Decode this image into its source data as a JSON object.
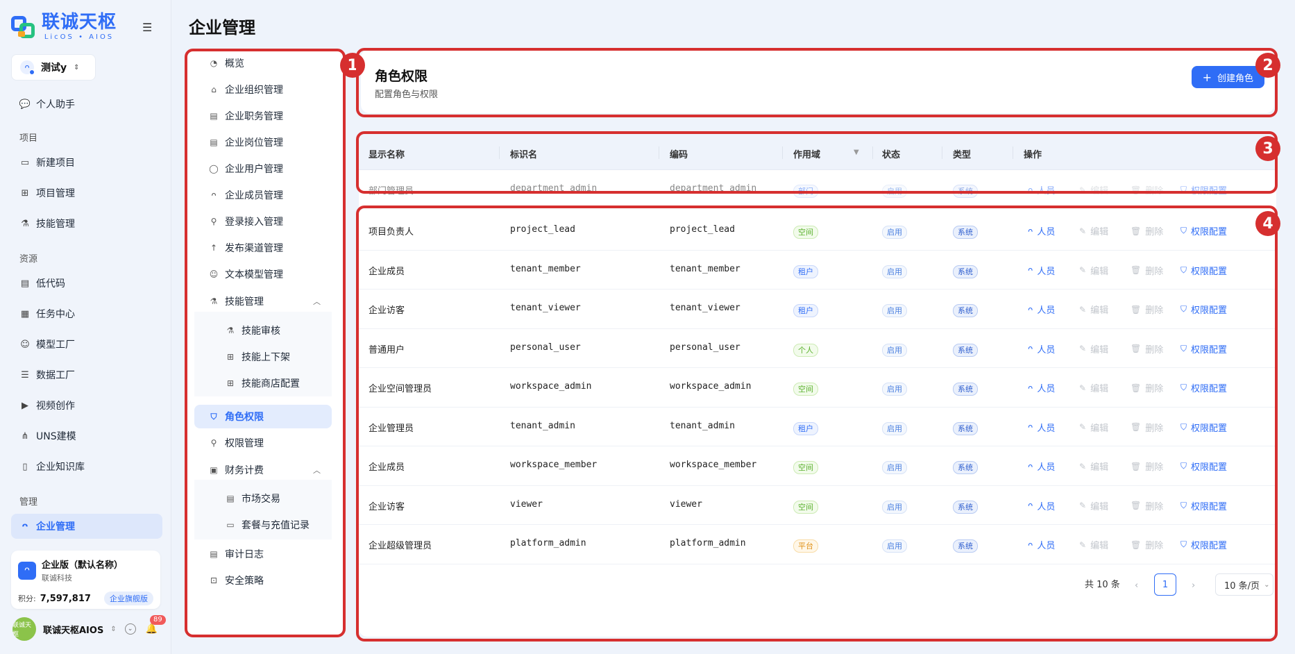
{
  "brand": {
    "title": "联诚天枢",
    "subtitle": "LicOS • AIOS"
  },
  "tenant_switch": {
    "label": "测试y"
  },
  "left_nav": {
    "top_items": [
      {
        "label": "个人助手",
        "icon": "chat-icon"
      }
    ],
    "groups": [
      {
        "label": "项目",
        "items": [
          {
            "label": "新建项目",
            "icon": "monitor-icon"
          },
          {
            "label": "项目管理",
            "icon": "grid-icon"
          },
          {
            "label": "技能管理",
            "icon": "flask-icon"
          }
        ]
      },
      {
        "label": "资源",
        "items": [
          {
            "label": "低代码",
            "icon": "doc-icon"
          },
          {
            "label": "任务中心",
            "icon": "calendar-icon"
          },
          {
            "label": "模型工厂",
            "icon": "robot-icon"
          },
          {
            "label": "数据工厂",
            "icon": "database-icon"
          },
          {
            "label": "视频创作",
            "icon": "video-icon"
          },
          {
            "label": "UNS建模",
            "icon": "nodes-icon"
          },
          {
            "label": "企业知识库",
            "icon": "book-icon"
          }
        ]
      },
      {
        "label": "管理",
        "items": [
          {
            "label": "企业管理",
            "icon": "users-icon",
            "active": true
          }
        ]
      }
    ]
  },
  "enterprise_card": {
    "name": "企业版（默认名称）",
    "org": "联诚科技",
    "points_label": "积分:",
    "points_value": "7,597,817",
    "plan": "企业旗舰版"
  },
  "bottom_user": {
    "avatar_text": "联诚天枢",
    "name": "联诚天枢AIOS",
    "notifications": "89"
  },
  "page": {
    "title": "企业管理"
  },
  "sub_nav": [
    {
      "label": "概览",
      "icon": "dashboard-icon"
    },
    {
      "label": "企业组织管理",
      "icon": "building-icon"
    },
    {
      "label": "企业职务管理",
      "icon": "doc-icon"
    },
    {
      "label": "企业岗位管理",
      "icon": "doc-icon"
    },
    {
      "label": "企业用户管理",
      "icon": "user-icon"
    },
    {
      "label": "企业成员管理",
      "icon": "users-icon"
    },
    {
      "label": "登录接入管理",
      "icon": "key-icon"
    },
    {
      "label": "发布渠道管理",
      "icon": "rocket-icon"
    },
    {
      "label": "文本模型管理",
      "icon": "robot-icon"
    },
    {
      "label": "技能管理",
      "icon": "flask-icon",
      "expanded": true
    },
    {
      "label": "技能审核",
      "icon": "flask-icon",
      "child": true
    },
    {
      "label": "技能上下架",
      "icon": "grid-icon",
      "child": true
    },
    {
      "label": "技能商店配置",
      "icon": "grid-icon",
      "child": true
    },
    {
      "label": "角色权限",
      "icon": "shield-icon",
      "active": true
    },
    {
      "label": "权限管理",
      "icon": "key-icon"
    },
    {
      "label": "财务计费",
      "icon": "wallet-icon",
      "expanded": true
    },
    {
      "label": "市场交易",
      "icon": "store-icon",
      "child": true
    },
    {
      "label": "套餐与充值记录",
      "icon": "card-icon",
      "child": true
    },
    {
      "label": "审计日志",
      "icon": "doc-icon"
    },
    {
      "label": "安全策略",
      "icon": "lock-icon"
    }
  ],
  "header": {
    "title": "角色权限",
    "subtitle": "配置角色与权限",
    "create_label": "创建角色"
  },
  "table": {
    "columns": [
      "显示名称",
      "标识名",
      "编码",
      "作用域",
      "状态",
      "类型",
      "操作"
    ],
    "actions": {
      "members": "人员",
      "edit": "编辑",
      "delete": "删除",
      "permissions": "权限配置"
    },
    "rows": [
      {
        "name": "部门管理员",
        "identifier": "department_admin",
        "code": "department_admin",
        "scope": "部门",
        "status": "启用",
        "type": "系统"
      },
      {
        "name": "项目负责人",
        "identifier": "project_lead",
        "code": "project_lead",
        "scope": "空间",
        "status": "启用",
        "type": "系统"
      },
      {
        "name": "企业成员",
        "identifier": "tenant_member",
        "code": "tenant_member",
        "scope": "租户",
        "status": "启用",
        "type": "系统"
      },
      {
        "name": "企业访客",
        "identifier": "tenant_viewer",
        "code": "tenant_viewer",
        "scope": "租户",
        "status": "启用",
        "type": "系统"
      },
      {
        "name": "普通用户",
        "identifier": "personal_user",
        "code": "personal_user",
        "scope": "个人",
        "status": "启用",
        "type": "系统"
      },
      {
        "name": "企业空间管理员",
        "identifier": "workspace_admin",
        "code": "workspace_admin",
        "scope": "空间",
        "status": "启用",
        "type": "系统"
      },
      {
        "name": "企业管理员",
        "identifier": "tenant_admin",
        "code": "tenant_admin",
        "scope": "租户",
        "status": "启用",
        "type": "系统"
      },
      {
        "name": "企业成员",
        "identifier": "workspace_member",
        "code": "workspace_member",
        "scope": "空间",
        "status": "启用",
        "type": "系统"
      },
      {
        "name": "企业访客",
        "identifier": "viewer",
        "code": "viewer",
        "scope": "空间",
        "status": "启用",
        "type": "系统"
      },
      {
        "name": "企业超级管理员",
        "identifier": "platform_admin",
        "code": "platform_admin",
        "scope": "平台",
        "status": "启用",
        "type": "系统"
      }
    ]
  },
  "pagination": {
    "total": "共 10 条",
    "current": "1",
    "page_size": "10 条/页"
  },
  "annotations": [
    "1",
    "2",
    "3",
    "4"
  ],
  "colors": {
    "accent": "#2f6df6",
    "highlight": "#d62f2f"
  }
}
